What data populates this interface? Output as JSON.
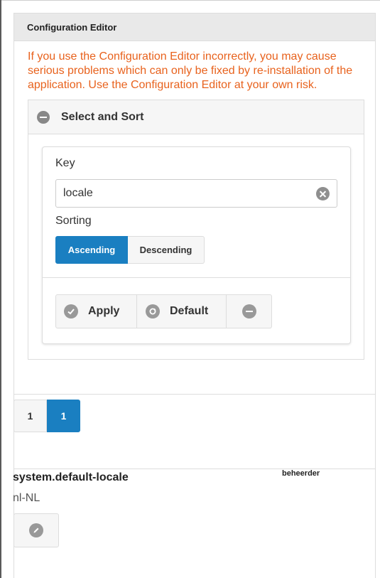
{
  "panel": {
    "title": "Configuration Editor",
    "warning": "If you use the Configuration Editor incorrectly, you may cause serious problems which can only be fixed by re-installation of the application. Use the Configuration Editor at your own risk."
  },
  "select_sort": {
    "header": "Select and Sort",
    "key_label": "Key",
    "key_value": "locale",
    "sorting_label": "Sorting",
    "sort_ascending": "Ascending",
    "sort_descending": "Descending",
    "selected_sort": "Ascending",
    "apply_label": "Apply",
    "default_label": "Default"
  },
  "pagination": {
    "pages": [
      "1",
      "1"
    ],
    "current": "1"
  },
  "entry": {
    "key": "system.default-locale",
    "value": "nl-NL",
    "owner": "beheerder"
  },
  "colors": {
    "warning": "#e8621d",
    "primary": "#1a7fc1",
    "icon_gray": "#999999"
  }
}
